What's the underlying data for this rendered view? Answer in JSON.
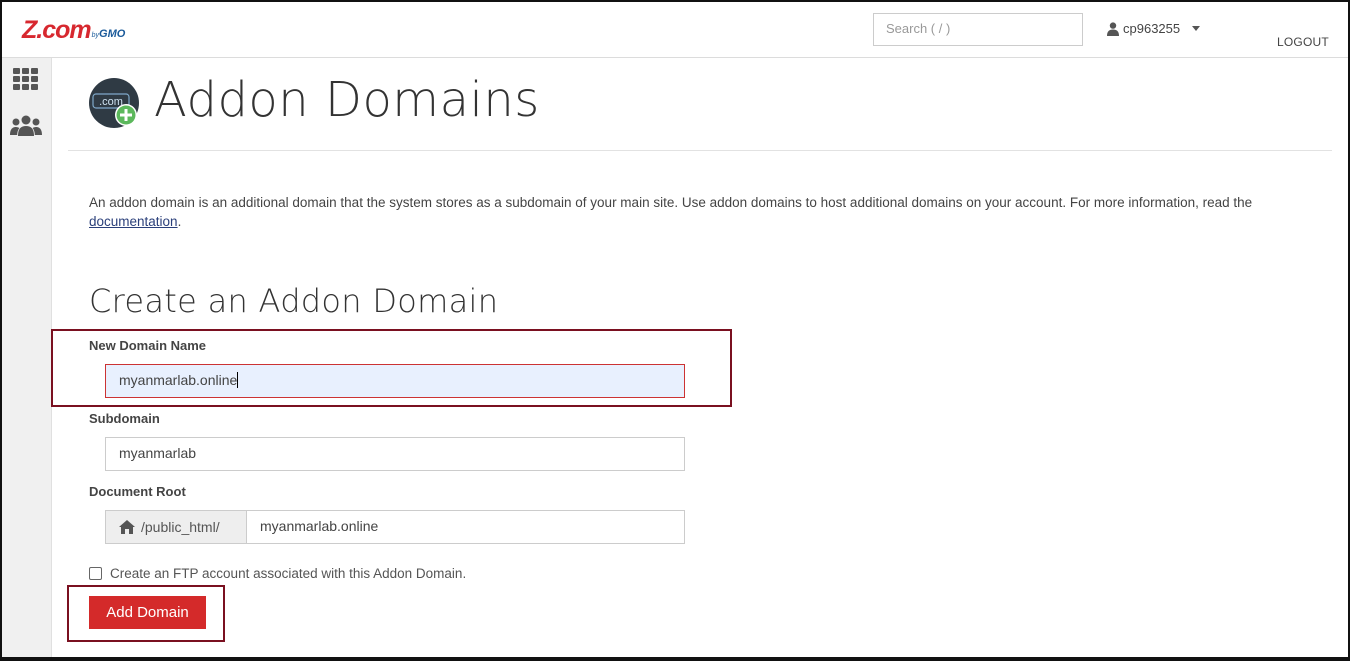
{
  "header": {
    "logo_main": "Z.com",
    "logo_by": "by",
    "logo_brand": "GMO",
    "search_placeholder": "Search ( / )",
    "username": "cp963255",
    "logout_label": "LOGOUT"
  },
  "sidebar": {
    "items": [
      {
        "name": "grid-icon"
      },
      {
        "name": "users-icon"
      }
    ]
  },
  "page": {
    "icon_text": ".com",
    "title": "Addon Domains",
    "description_pre": "An addon domain is an additional domain that the system stores as a subdomain of your main site. Use addon domains to host additional domains on your account. For more information, read the ",
    "description_link": "documentation",
    "description_post": "."
  },
  "form": {
    "section_title": "Create an Addon Domain",
    "new_domain_label": "New Domain Name",
    "new_domain_value": "myanmarlab.online",
    "subdomain_label": "Subdomain",
    "subdomain_value": "myanmarlab",
    "docroot_label": "Document Root",
    "docroot_prefix": "/public_html/",
    "docroot_value": "myanmarlab.online",
    "ftp_label": "Create an FTP account associated with this Addon Domain.",
    "ftp_checked": false,
    "submit_label": "Add Domain"
  },
  "colors": {
    "accent": "#d42a2a",
    "highlight": "#7a1020",
    "brand": "#d7282f"
  }
}
